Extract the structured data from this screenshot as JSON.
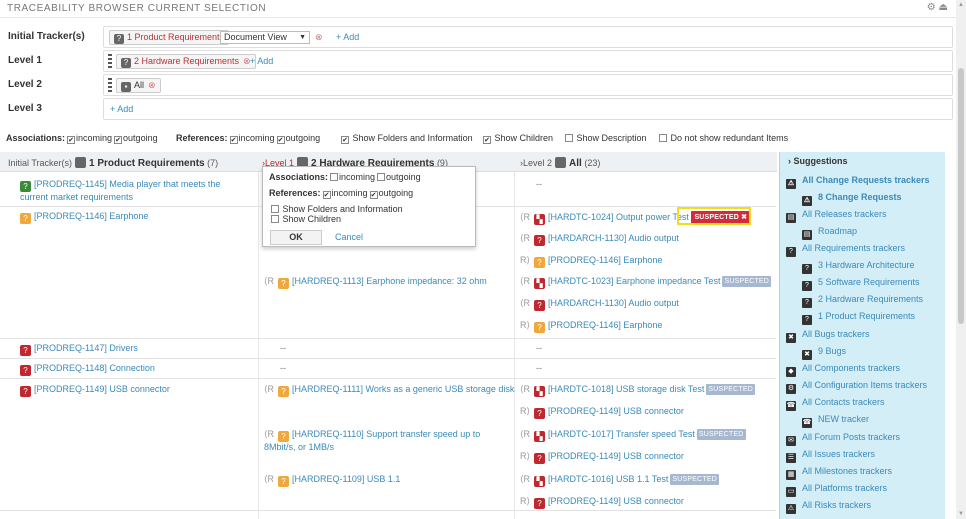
{
  "header": {
    "title": "TRACEABILITY BROWSER CURRENT SELECTION",
    "icons": [
      "gear-icon",
      "eject-icon"
    ]
  },
  "levels": {
    "initial_label": "Initial Tracker(s)",
    "initial_chip": "1 Product Requirements",
    "initial_view": "Document View",
    "add": "+ Add",
    "l1_label": "Level 1",
    "l1_chip": "2 Hardware Requirements",
    "l2_label": "Level 2",
    "l2_chip": "All",
    "l3_label": "Level 3"
  },
  "options": {
    "assoc": "Associations:",
    "incoming": "incoming",
    "outgoing": "outgoing",
    "refs": "References:",
    "folders": "Show Folders and Information",
    "children": "Show Children",
    "description": "Show Description",
    "redundant": "Do not show redundant Items"
  },
  "table": {
    "h0_pre": "Initial Tracker(s)",
    "h0": "1 Product Requirements",
    "h0_count": "(7)",
    "h1_pre": "Level 1",
    "h1": "2 Hardware Requirements",
    "h1_count": "(9)",
    "h2_pre": "Level 2",
    "h2": "All",
    "h2_count": "(23)",
    "dash": "--",
    "in_arrow": "⟨R",
    "out_arrow": "R⟩",
    "suspected": "SUSPECTED",
    "suspected_x": "SUSPECTED ✖",
    "c0": [
      "[PRODREQ-1145] Media player that meets the current market requirements",
      "[PRODREQ-1146] Earphone",
      "[PRODREQ-1147] Drivers",
      "[PRODREQ-1148] Connection",
      "[PRODREQ-1149] USB connector"
    ],
    "c1": [
      "[HARDREQ-1113] Earphone impedance: 32 ohm",
      "[HARDREQ-1111] Works as a generic USB storage disk",
      "[HARDREQ-1110] Support transfer speed up to 8Mbit/s, or 1MB/s",
      "[HARDREQ-1109] USB 1.1"
    ],
    "c2": [
      "[HARDTC-1024] Output power Test",
      "[HARDARCH-1130] Audio output",
      "[PRODREQ-1146] Earphone",
      "[HARDTC-1023] Earphone impedance Test",
      "[HARDARCH-1130] Audio output",
      "[PRODREQ-1146] Earphone",
      "[HARDTC-1018] USB storage disk Test",
      "[PRODREQ-1149] USB connector",
      "[HARDTC-1017] Transfer speed Test",
      "[PRODREQ-1149] USB connector",
      "[HARDTC-1016] USB 1.1 Test",
      "[PRODREQ-1149] USB connector"
    ]
  },
  "popup": {
    "assoc": "Associations:",
    "incoming": "incoming",
    "outgoing": "outgoing",
    "refs": "References:",
    "folders": "Show Folders and Information",
    "children": "Show Children",
    "ok": "OK",
    "cancel": "Cancel"
  },
  "sidebar": {
    "header": "› Suggestions",
    "items": [
      "All Change Requests trackers",
      "8 Change Requests",
      "All Releases trackers",
      "Roadmap",
      "All Requirements trackers",
      "3 Hardware Architecture",
      "5 Software Requirements",
      "2 Hardware Requirements",
      "1 Product Requirements",
      "All Bugs trackers",
      "9 Bugs",
      "All Components trackers",
      "All Configuration Items trackers",
      "All Contacts trackers",
      "NEW tracker",
      "All Forum Posts trackers",
      "All Issues trackers",
      "All Milestones trackers",
      "All Platforms trackers",
      "All Risks trackers"
    ]
  }
}
